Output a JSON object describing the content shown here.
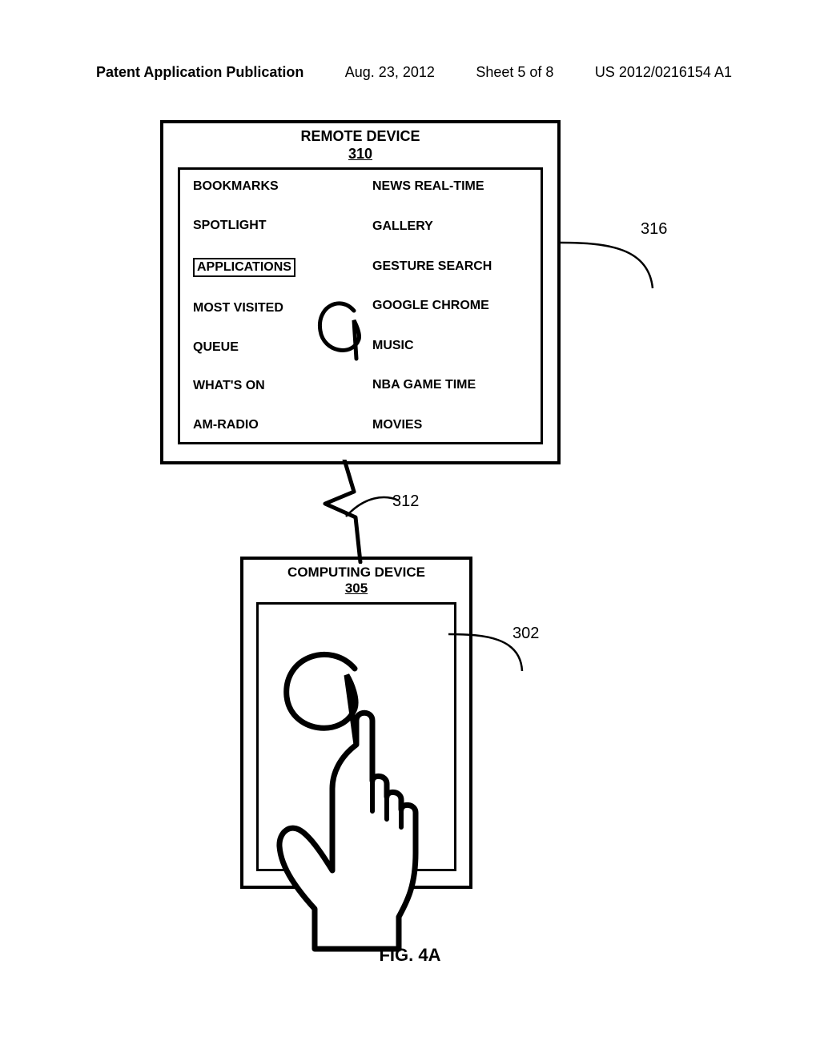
{
  "header": {
    "publication": "Patent Application Publication",
    "date": "Aug. 23, 2012",
    "sheet": "Sheet 5 of 8",
    "pubno": "US 2012/0216154 A1"
  },
  "remote": {
    "title": "REMOTE DEVICE",
    "ref": "310",
    "left_items": [
      "BOOKMARKS",
      "SPOTLIGHT",
      "APPLICATIONS",
      "MOST VISITED",
      "QUEUE",
      "WHAT'S ON",
      "AM-RADIO"
    ],
    "selected_index": 2,
    "right_items": [
      "NEWS REAL-TIME",
      "GALLERY",
      "GESTURE SEARCH",
      "GOOGLE CHROME",
      "MUSIC",
      "NBA GAME TIME",
      "MOVIES"
    ]
  },
  "labels": {
    "l316": "316",
    "l312": "312",
    "l302": "302"
  },
  "computing": {
    "title": "COMPUTING DEVICE",
    "ref": "305"
  },
  "figure": "FIG. 4A"
}
